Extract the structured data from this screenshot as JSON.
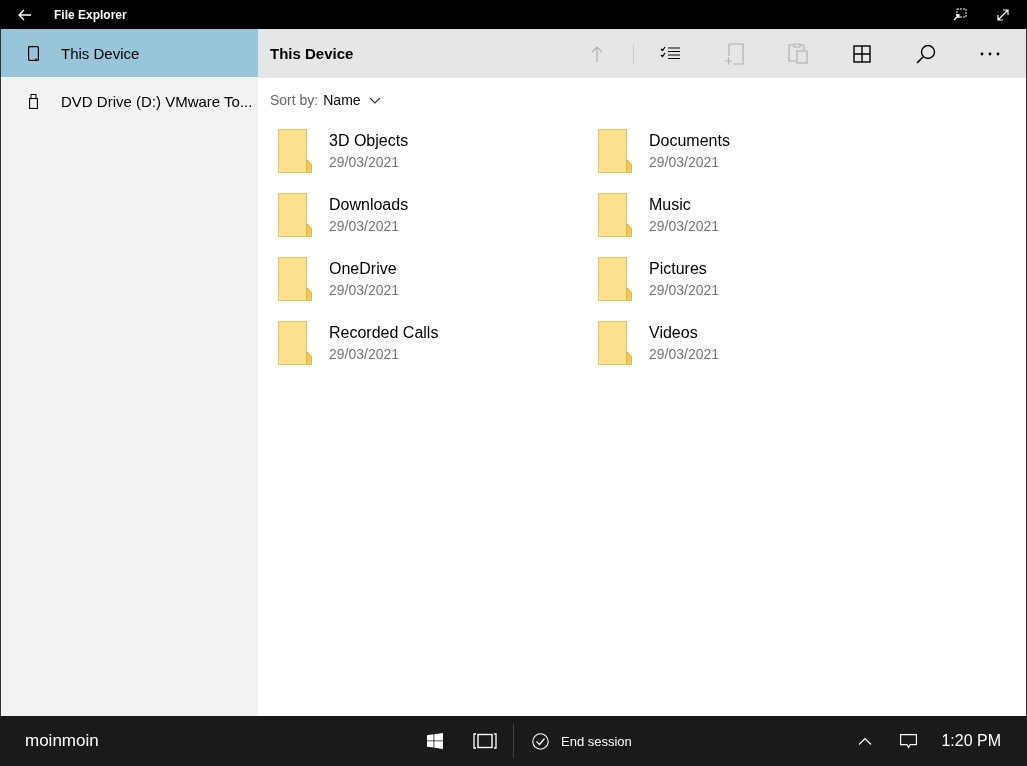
{
  "window": {
    "title": "File Explorer"
  },
  "sidebar": {
    "items": [
      {
        "label": "This Device",
        "kind": "device",
        "selected": true
      },
      {
        "label": "DVD Drive (D:) VMware To...",
        "kind": "drive",
        "selected": false
      }
    ]
  },
  "header": {
    "title": "This Device"
  },
  "toolbar": [
    {
      "kind": "up",
      "disabled": true
    },
    {
      "kind": "select",
      "disabled": false
    },
    {
      "kind": "new",
      "disabled": true
    },
    {
      "kind": "paste",
      "disabled": true
    },
    {
      "kind": "view",
      "disabled": false
    },
    {
      "kind": "search",
      "disabled": false
    },
    {
      "kind": "more",
      "disabled": false
    }
  ],
  "sort": {
    "label": "Sort by:",
    "value": "Name"
  },
  "folders": [
    {
      "name": "3D Objects",
      "date": "29/03/2021"
    },
    {
      "name": "Documents",
      "date": "29/03/2021"
    },
    {
      "name": "Downloads",
      "date": "29/03/2021"
    },
    {
      "name": "Music",
      "date": "29/03/2021"
    },
    {
      "name": "OneDrive",
      "date": "29/03/2021"
    },
    {
      "name": "Pictures",
      "date": "29/03/2021"
    },
    {
      "name": "Recorded Calls",
      "date": "29/03/2021"
    },
    {
      "name": "Videos",
      "date": "29/03/2021"
    }
  ],
  "taskbar": {
    "user": "moinmoin",
    "end_session": "End session",
    "time": "1:20 PM"
  }
}
